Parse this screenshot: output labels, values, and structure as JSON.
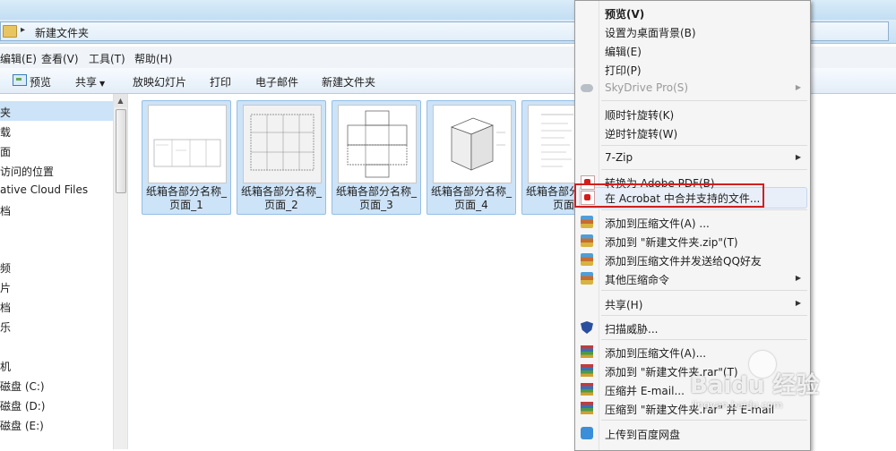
{
  "address": {
    "path": "新建文件夹"
  },
  "menubar": [
    "编辑(E)",
    "查看(V)",
    "工具(T)",
    "帮助(H)"
  ],
  "toolbar": {
    "preview": "预览",
    "share": "共享",
    "slideshow": "放映幻灯片",
    "print": "打印",
    "email": "电子邮件",
    "new_folder": "新建文件夹"
  },
  "nav": {
    "items": [
      "夹",
      "载",
      "面",
      "访问的位置",
      "ative Cloud Files",
      "档",
      "频",
      "片",
      "档",
      "乐",
      "机",
      "磁盘 (C:)",
      "磁盘 (D:)",
      "磁盘 (E:)"
    ]
  },
  "files": [
    {
      "line1": "纸箱各部分名称_",
      "line2": "页面_1"
    },
    {
      "line1": "纸箱各部分名称_",
      "line2": "页面_2"
    },
    {
      "line1": "纸箱各部分名称_",
      "line2": "页面_3"
    },
    {
      "line1": "纸箱各部分名称_",
      "line2": "页面_4"
    },
    {
      "line1": "纸箱各部分名称_",
      "line2": "页面_"
    }
  ],
  "context_menu": {
    "items": [
      {
        "label": "预览(V)",
        "bold": true
      },
      {
        "label": "设置为桌面背景(B)"
      },
      {
        "label": "编辑(E)"
      },
      {
        "label": "打印(P)"
      },
      {
        "label": "SkyDrive Pro(S)",
        "disabled": true,
        "submenu": true,
        "icon": "cloud-icon"
      },
      {
        "label": "顺时针旋转(K)"
      },
      {
        "label": "逆时针旋转(W)"
      },
      {
        "label": "7-Zip",
        "submenu": true
      },
      {
        "label": "转换为 Adobe PDF(B)",
        "icon": "pdf-icon"
      },
      {
        "label": "在 Acrobat 中合并支持的文件...",
        "icon": "acrobat-combine-icon",
        "highlighted": true
      },
      {
        "label": "添加到压缩文件(A) ...",
        "icon": "zip-icon"
      },
      {
        "label": "添加到 \"新建文件夹.zip\"(T)",
        "icon": "zip-icon"
      },
      {
        "label": "添加到压缩文件并发送给QQ好友",
        "icon": "zip-icon"
      },
      {
        "label": "其他压缩命令",
        "icon": "zip-icon",
        "submenu": true
      },
      {
        "label": "共享(H)",
        "submenu": true
      },
      {
        "label": "扫描威胁...",
        "icon": "shield-icon"
      },
      {
        "label": "添加到压缩文件(A)...",
        "icon": "winrar-icon"
      },
      {
        "label": "添加到 \"新建文件夹.rar\"(T)",
        "icon": "winrar-icon"
      },
      {
        "label": "压缩并 E-mail...",
        "icon": "winrar-icon"
      },
      {
        "label": "压缩到 \"新建文件夹.rar\" 并 E-mail",
        "icon": "winrar-icon"
      },
      {
        "label": "上传到百度网盘",
        "icon": "baidu-cloud-icon"
      }
    ]
  },
  "watermark": {
    "main": "Baidu 经验",
    "sub": "jingyan.baidu.com"
  },
  "colors": {
    "highlight_border": "#d02020",
    "selection": "#cde3f7"
  }
}
